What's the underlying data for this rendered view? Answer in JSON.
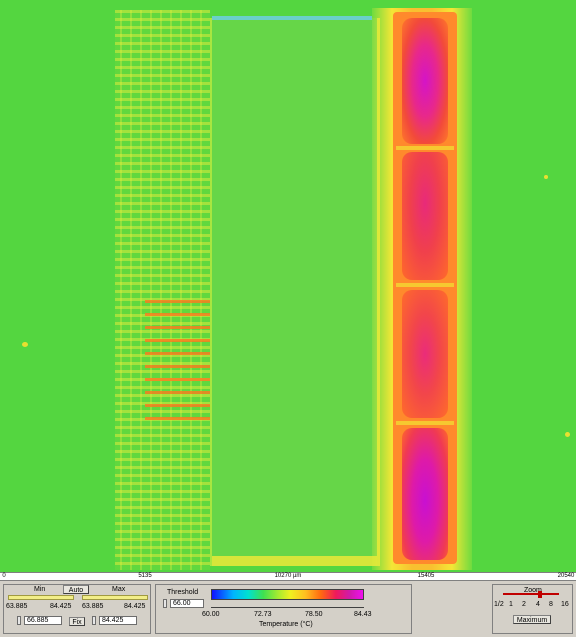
{
  "ruler": {
    "ticks": [
      "0",
      "5135",
      "10270 µm",
      "15405",
      "20540"
    ]
  },
  "minmax": {
    "min_label": "Min",
    "auto_label": "Auto",
    "max_label": "Max",
    "min_range_low": "63.885",
    "min_range_high": "84.425",
    "max_range_low": "63.885",
    "max_range_high": "84.425",
    "min_value": "66.885",
    "fix_label": "Fix",
    "max_value": "84.425"
  },
  "threshold": {
    "label": "Threshold",
    "value": "66.00"
  },
  "colorscale": {
    "ticks": [
      "60.00",
      "72.73",
      "78.50",
      "84.43"
    ],
    "axis_label": "Temperature (°C)",
    "colors": [
      "#1010ff",
      "#00b4ff",
      "#3fe050",
      "#f0f020",
      "#ff6a10",
      "#d01aa8",
      "#ee10ee"
    ]
  },
  "zoom": {
    "label": "Zoom",
    "levels": [
      "1/2",
      "1",
      "2",
      "4",
      "8",
      "16"
    ],
    "selected_level": "4",
    "button_label": "Maximum"
  }
}
